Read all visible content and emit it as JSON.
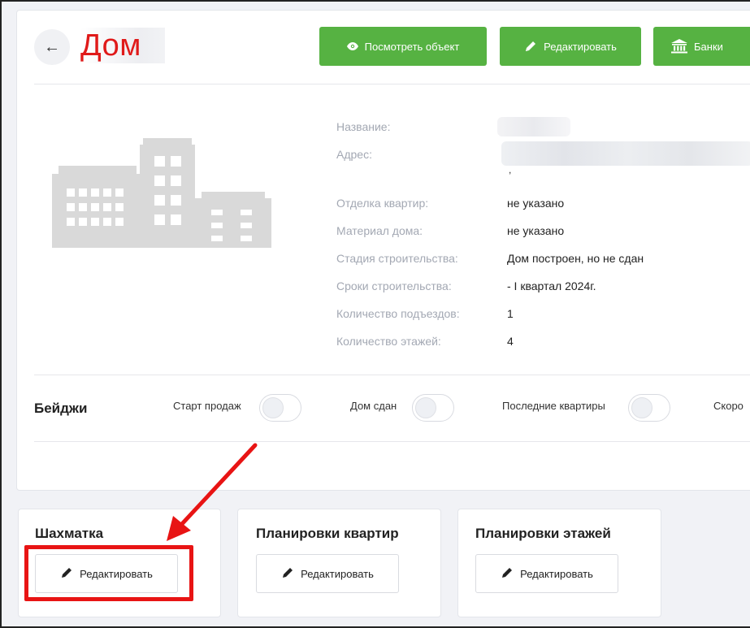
{
  "header": {
    "title": "Дом",
    "buttons": {
      "view": "Посмотреть объект",
      "edit": "Редактировать",
      "banks": "Банки"
    }
  },
  "info": {
    "rows": [
      {
        "label": "Название:",
        "value": ""
      },
      {
        "label": "Адрес:",
        "value": ""
      },
      {
        "label": "Отделка квартир:",
        "value": "не указано"
      },
      {
        "label": "Материал дома:",
        "value": "не указано"
      },
      {
        "label": "Стадия строительства:",
        "value": "Дом построен, но не сдан"
      },
      {
        "label": "Сроки строительства:",
        "value": "- I квартал 2024г."
      },
      {
        "label": "Количество подъездов:",
        "value": "1"
      },
      {
        "label": "Количество этажей:",
        "value": "4"
      }
    ],
    "stray_mark": ","
  },
  "badges": {
    "title": "Бейджи",
    "items": [
      {
        "label": "Старт продаж",
        "on": false
      },
      {
        "label": "Дом сдан",
        "on": false
      },
      {
        "label": "Последние квартиры",
        "on": false
      },
      {
        "label": "Скоро",
        "on": false
      }
    ]
  },
  "cards": [
    {
      "title": "Шахматка",
      "button": "Редактировать"
    },
    {
      "title": "Планировки квартир",
      "button": "Редактировать"
    },
    {
      "title": "Планировки этажей",
      "button": "Редактировать"
    }
  ],
  "colors": {
    "accent_green": "#56b242",
    "annotation_red": "#e81414",
    "title_red": "#e01a1a",
    "label_gray": "#a3a8b3"
  },
  "icons": {
    "back": "arrow-left-icon",
    "view": "eye-icon",
    "edit": "pencil-icon",
    "banks": "bank-icon",
    "building": "building-placeholder-icon"
  }
}
